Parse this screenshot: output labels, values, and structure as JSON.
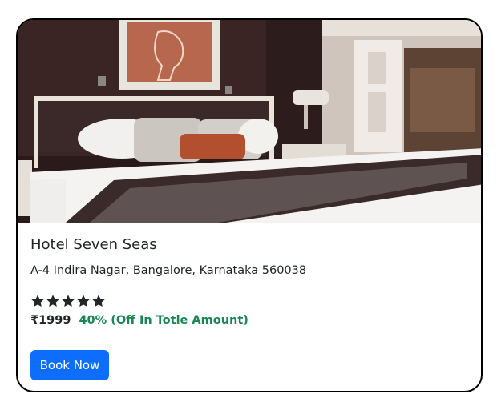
{
  "hotel": {
    "name": "Hotel Seven Seas",
    "address": "A-4 Indira Nagar, Bangalore, Karnataka 560038",
    "rating": 5,
    "price": "₹1999",
    "discount": "40% (Off In Totle Amount)"
  },
  "actions": {
    "book_label": "Book Now"
  },
  "colors": {
    "primary": "#0d6efd",
    "success": "#198754",
    "text": "#212529"
  },
  "icons": {
    "rating": "star-icon"
  }
}
